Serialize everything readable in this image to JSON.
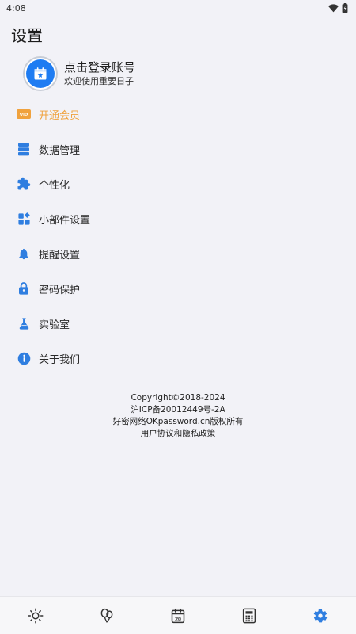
{
  "status_bar": {
    "time": "4:08",
    "wifi_icon": "wifi-icon",
    "battery_icon": "battery-icon"
  },
  "header": {
    "title": "设置"
  },
  "profile": {
    "name": "点击登录账号",
    "subtitle": "欢迎使用重要日子",
    "avatar_icon": "calendar-star-icon",
    "avatar_color": "#1e7cf2"
  },
  "menu": {
    "items": [
      {
        "label": "开通会员",
        "icon": "vip-icon",
        "color": "#f0a23e"
      },
      {
        "label": "数据管理",
        "icon": "database-icon",
        "color": "#2f7ee0"
      },
      {
        "label": "个性化",
        "icon": "puzzle-icon",
        "color": "#2f7ee0"
      },
      {
        "label": "小部件设置",
        "icon": "widgets-icon",
        "color": "#2f7ee0"
      },
      {
        "label": "提醒设置",
        "icon": "bell-icon",
        "color": "#2f7ee0"
      },
      {
        "label": "密码保护",
        "icon": "lock-icon",
        "color": "#2f7ee0"
      },
      {
        "label": "实验室",
        "icon": "flask-icon",
        "color": "#2f7ee0"
      },
      {
        "label": "关于我们",
        "icon": "info-icon",
        "color": "#2f7ee0"
      }
    ]
  },
  "footer": {
    "copyright": "Copyright©2018-2024",
    "icp": "沪ICP备20012449号-2A",
    "owner": "好密网络OKpassword.cn版权所有",
    "user_agreement": "用户协议",
    "and": "和",
    "privacy_policy": "隐私政策"
  },
  "bottom_nav": {
    "items": [
      {
        "icon": "sun-icon"
      },
      {
        "icon": "balloons-icon"
      },
      {
        "icon": "calendar-icon",
        "day": "20"
      },
      {
        "icon": "calculator-icon"
      },
      {
        "icon": "settings-icon",
        "active": true
      }
    ],
    "active_color": "#2f7ee0",
    "inactive_color": "#333333"
  }
}
